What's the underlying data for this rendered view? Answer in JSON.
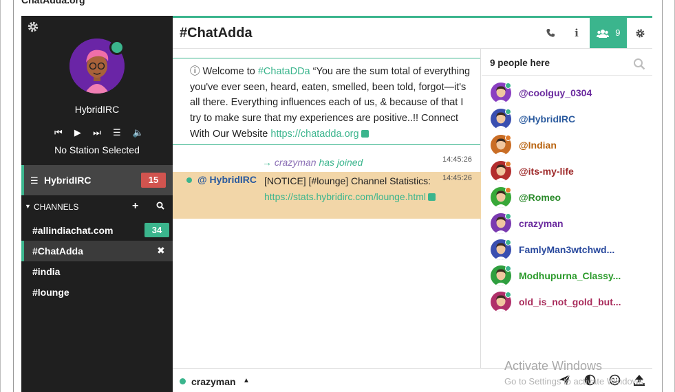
{
  "window": {
    "title": "ChatAdda.org"
  },
  "sidebar": {
    "user": {
      "nick": "HybridIRC",
      "status_color": "#3bb58d"
    },
    "player": {
      "station": "No Station Selected",
      "controls": [
        "prev",
        "play",
        "next",
        "list",
        "volume"
      ]
    },
    "network": {
      "name": "HybridIRC",
      "badge": "15"
    },
    "channels_header": {
      "label": "CHANNELS"
    },
    "channels": [
      {
        "name": "#allindiachat.com",
        "badge": "34",
        "active": false
      },
      {
        "name": "#ChatAdda",
        "badge": "",
        "active": true
      },
      {
        "name": "#india",
        "badge": "",
        "active": false
      },
      {
        "name": "#lounge",
        "badge": "",
        "active": false
      }
    ]
  },
  "header": {
    "channel": "#ChatAdda",
    "people_count": "9"
  },
  "topic": {
    "prefix": "ⓘ Welcome to ",
    "channel_link": "#ChataDDa",
    "text": " “You are the sum total of everything you've ever seen, heard, eaten, smelled, been told, forgot—it's all there. Everything influences each of us, & because of that I try to make sure that my experiences are positive..!! Connect With Our Website ",
    "url": "https://chatadda.org"
  },
  "messages": {
    "join": {
      "arrow": "→",
      "nick": "crazyman",
      "text": "has joined",
      "time": "14:45:26"
    },
    "notice": {
      "nick": "@ HybridIRC",
      "text": "[NOTICE] [#lounge] Channel Statistics:",
      "url": "https://stats.hybridirc.com/lounge.html",
      "time": "14:45:26"
    }
  },
  "userlist": {
    "count_label": "9 people here",
    "users": [
      {
        "name": "@coolguy_0304",
        "color": "#6a2a9e",
        "status": "#3bb58d",
        "avatar": "#8a3fc1"
      },
      {
        "name": "@HybridIRC",
        "color": "#2a5a9e",
        "status": "#3bb58d",
        "avatar": "#3a4fb0"
      },
      {
        "name": "@Indian",
        "color": "#b8620e",
        "status": "#e07b2a",
        "avatar": "#c96d25"
      },
      {
        "name": "@its-my-life",
        "color": "#9e2a2a",
        "status": "#e07b2a",
        "avatar": "#b32e2e"
      },
      {
        "name": "@Romeo",
        "color": "#2a8a2a",
        "status": "#e07b2a",
        "avatar": "#38a838"
      },
      {
        "name": "crazyman",
        "color": "#6a2a9e",
        "status": "#3bb58d",
        "avatar": "#7a3ab0"
      },
      {
        "name": "FamlyMan3wtchwd...",
        "color": "#2a4a9e",
        "status": "#3bb58d",
        "avatar": "#3a4fb0"
      },
      {
        "name": "Modhupurna_Classy...",
        "color": "#2a9a2a",
        "status": "#3bb58d",
        "avatar": "#2f9f3f"
      },
      {
        "name": "old_is_not_gold_but...",
        "color": "#a82a5a",
        "status": "#3bb58d",
        "avatar": "#b0306a"
      }
    ]
  },
  "input": {
    "nick": "crazyman"
  },
  "watermark": {
    "line1": "Activate Windows",
    "line2": "Go to Settings to activate Windows."
  }
}
